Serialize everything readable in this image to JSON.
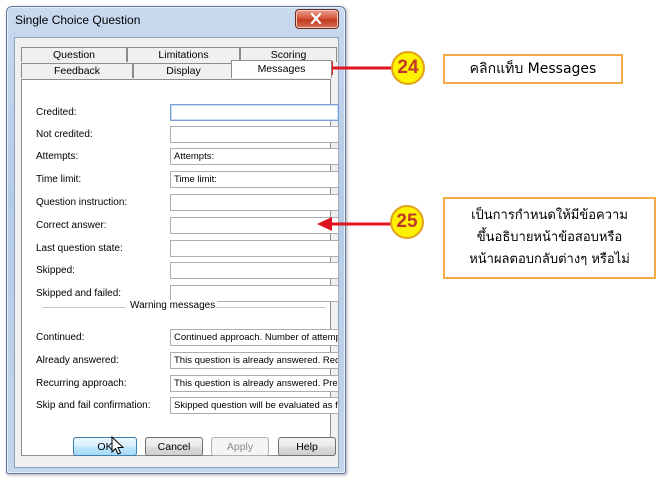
{
  "window": {
    "title": "Single Choice Question",
    "tabs_back": [
      "Question",
      "Limitations",
      "Scoring"
    ],
    "tabs_front": [
      "Feedback",
      "Display",
      "Messages"
    ],
    "active_tab": "Messages"
  },
  "fields": [
    {
      "label": "Credited:",
      "value": ""
    },
    {
      "label": "Not credited:",
      "value": ""
    },
    {
      "label": "Attempts:",
      "value": "Attempts:"
    },
    {
      "label": "Time limit:",
      "value": "Time limit:"
    },
    {
      "label": "Question instruction:",
      "value": ""
    },
    {
      "label": "Correct answer:",
      "value": ""
    },
    {
      "label": "Last question state:",
      "value": ""
    },
    {
      "label": "Skipped:",
      "value": ""
    },
    {
      "label": "Skipped and failed:",
      "value": ""
    }
  ],
  "warning": {
    "title": "Warning messages",
    "fields": [
      {
        "label": "Continued:",
        "value": "Continued approach. Number of attempt"
      },
      {
        "label": "Already answered:",
        "value": "This question is already answered. Recu"
      },
      {
        "label": "Recurring approach:",
        "value": "This question is already answered. Press"
      },
      {
        "label": "Skip and fail confirmation:",
        "value": "Skipped question will be evaluated as fa"
      }
    ]
  },
  "buttons": {
    "ok": "OK",
    "cancel": "Cancel",
    "apply": "Apply",
    "help": "Help"
  },
  "annotations": {
    "step24": {
      "number": "24",
      "text": "คลิกแท็บ Messages"
    },
    "step25": {
      "number": "25",
      "lines": [
        "เป็นการกำหนดให้มีข้อความ",
        "ขึ้นอธิบายหน้าข้อสอบหรือ",
        "หน้าผลตอบกลับต่างๆ หรือไม่"
      ]
    }
  },
  "colors": {
    "accent_red": "#e0141e",
    "badge_yellow": "#fff200",
    "note_border": "#f3a948"
  }
}
